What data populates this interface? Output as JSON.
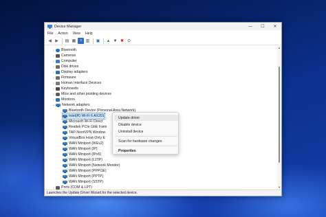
{
  "window": {
    "title": "Device Manager",
    "controls": {
      "minimize": "—",
      "maximize": "☐",
      "close": "✕"
    }
  },
  "menu": [
    "File",
    "Action",
    "View",
    "Help"
  ],
  "toolbar": [
    {
      "icon": "back-arrow-icon",
      "glyph": "◀"
    },
    {
      "icon": "forward-arrow-icon",
      "glyph": "▶"
    },
    {
      "icon": "tree-view-icon",
      "glyph": "▤"
    },
    {
      "icon": "properties-icon",
      "glyph": "▦"
    },
    {
      "icon": "help-icon",
      "glyph": "?"
    },
    {
      "icon": "device-view-icon",
      "glyph": "▥"
    },
    {
      "icon": "monitor-scan-icon",
      "glyph": "▣"
    },
    {
      "icon": "update-driver-icon",
      "glyph": "▲"
    },
    {
      "icon": "disable-device-icon",
      "glyph": "▼"
    },
    {
      "icon": "uninstall-device-icon",
      "glyph": "✖"
    },
    {
      "icon": "scan-hardware-icon",
      "glyph": "⊙"
    }
  ],
  "tree": {
    "categories_before": [
      {
        "label": "Bluetooth",
        "color": "#1e6fd9"
      },
      {
        "label": "Cameras",
        "color": "#555555"
      },
      {
        "label": "Computer",
        "color": "#3a7bd5"
      },
      {
        "label": "Disk drives",
        "color": "#6b6b6b"
      },
      {
        "label": "Display adapters",
        "color": "#2f6fb7"
      },
      {
        "label": "Firmware",
        "color": "#6b6b6b"
      },
      {
        "label": "Human Interface Devices",
        "color": "#7a7a7a"
      },
      {
        "label": "Keyboards",
        "color": "#4a4a4a"
      },
      {
        "label": "Mice and other pointing devices",
        "color": "#5a5a5a"
      },
      {
        "label": "Monitors",
        "color": "#2f6fb7"
      }
    ],
    "expanded_category": {
      "label": "Network adapters",
      "color": "#2a64a8"
    },
    "network_adapters": [
      "Bluetooth Device (Personal Area Network)",
      "Intel(R) Wi-Fi 6 AX201",
      "Microsoft Wi-Fi Direct",
      "Realtek PCIe GbE Fami",
      "TAP-NordVPN Window",
      "VirtualBox Host-Only E",
      "WAN Miniport (IKEv2)",
      "WAN Miniport (IP)",
      "WAN Miniport (IPv6)",
      "WAN Miniport (L2TP)",
      "WAN Miniport (Network Monitor)",
      "WAN Miniport (PPPOE)",
      "WAN Miniport (PPTP)",
      "WAN Miniport (SSTP)"
    ],
    "selected_index": 1,
    "categories_after": [
      {
        "label": "Ports (COM & LPT)",
        "color": "#5a5a5a"
      }
    ]
  },
  "context_menu": {
    "items": [
      "Update driver",
      "Disable device",
      "Uninstall device",
      "Scan for hardware changes",
      "Properties"
    ],
    "highlighted_index": 0
  },
  "status_bar": "Launches the Update Driver Wizard for the selected device."
}
